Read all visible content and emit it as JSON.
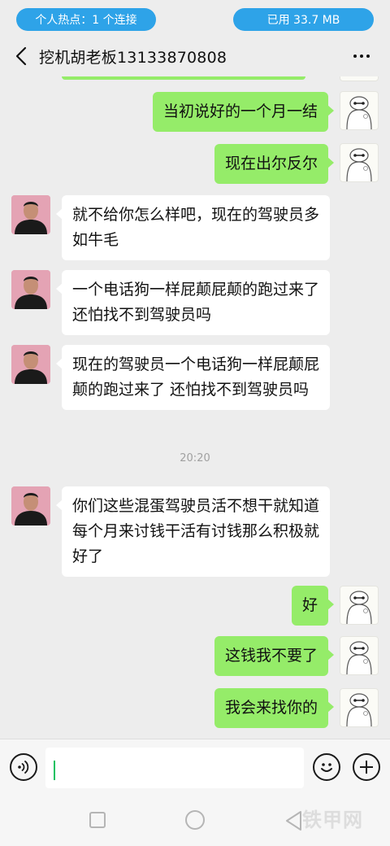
{
  "status_bar": {
    "hotspot": "个人热点：1 个连接",
    "data_used": "已用 33.7 MB"
  },
  "header": {
    "title": "挖机胡老板13133870808"
  },
  "messages": [
    {
      "side": "right",
      "text": "当初说好的一个月一结"
    },
    {
      "side": "right",
      "text": "现在出尔反尔"
    },
    {
      "side": "left",
      "text": "就不给你怎么样吧，现在的驾驶员多如牛毛"
    },
    {
      "side": "left",
      "text": "一个电话狗一样屁颠屁颠的跑过来了  还怕找不到驾驶员吗"
    },
    {
      "side": "left",
      "text": "现在的驾驶员一个电话狗一样屁颠屁颠的跑过来了  还怕找不到驾驶员吗"
    },
    {
      "side": "left",
      "text": "你们这些混蛋驾驶员活不想干就知道每个月来讨钱干活有讨钱那么积极就好了"
    },
    {
      "side": "right",
      "text": "好"
    },
    {
      "side": "right",
      "text": "这钱我不要了"
    },
    {
      "side": "right",
      "text": "我会来找你的"
    }
  ],
  "timestamp": "20:20",
  "input": {
    "value": "",
    "placeholder": ""
  },
  "watermark": "铁甲网",
  "icons": {
    "back": "chevron-left-icon",
    "more": "more-dots-icon",
    "voice": "voice-icon",
    "emoji": "emoji-icon",
    "plus": "plus-icon",
    "nav_recent": "square-icon",
    "nav_home": "circle-icon",
    "nav_back": "triangle-back-icon"
  },
  "colors": {
    "sent_bubble": "#95ec69",
    "received_bubble": "#ffffff",
    "status_pill": "#2ea3e8",
    "background": "#ededed"
  }
}
